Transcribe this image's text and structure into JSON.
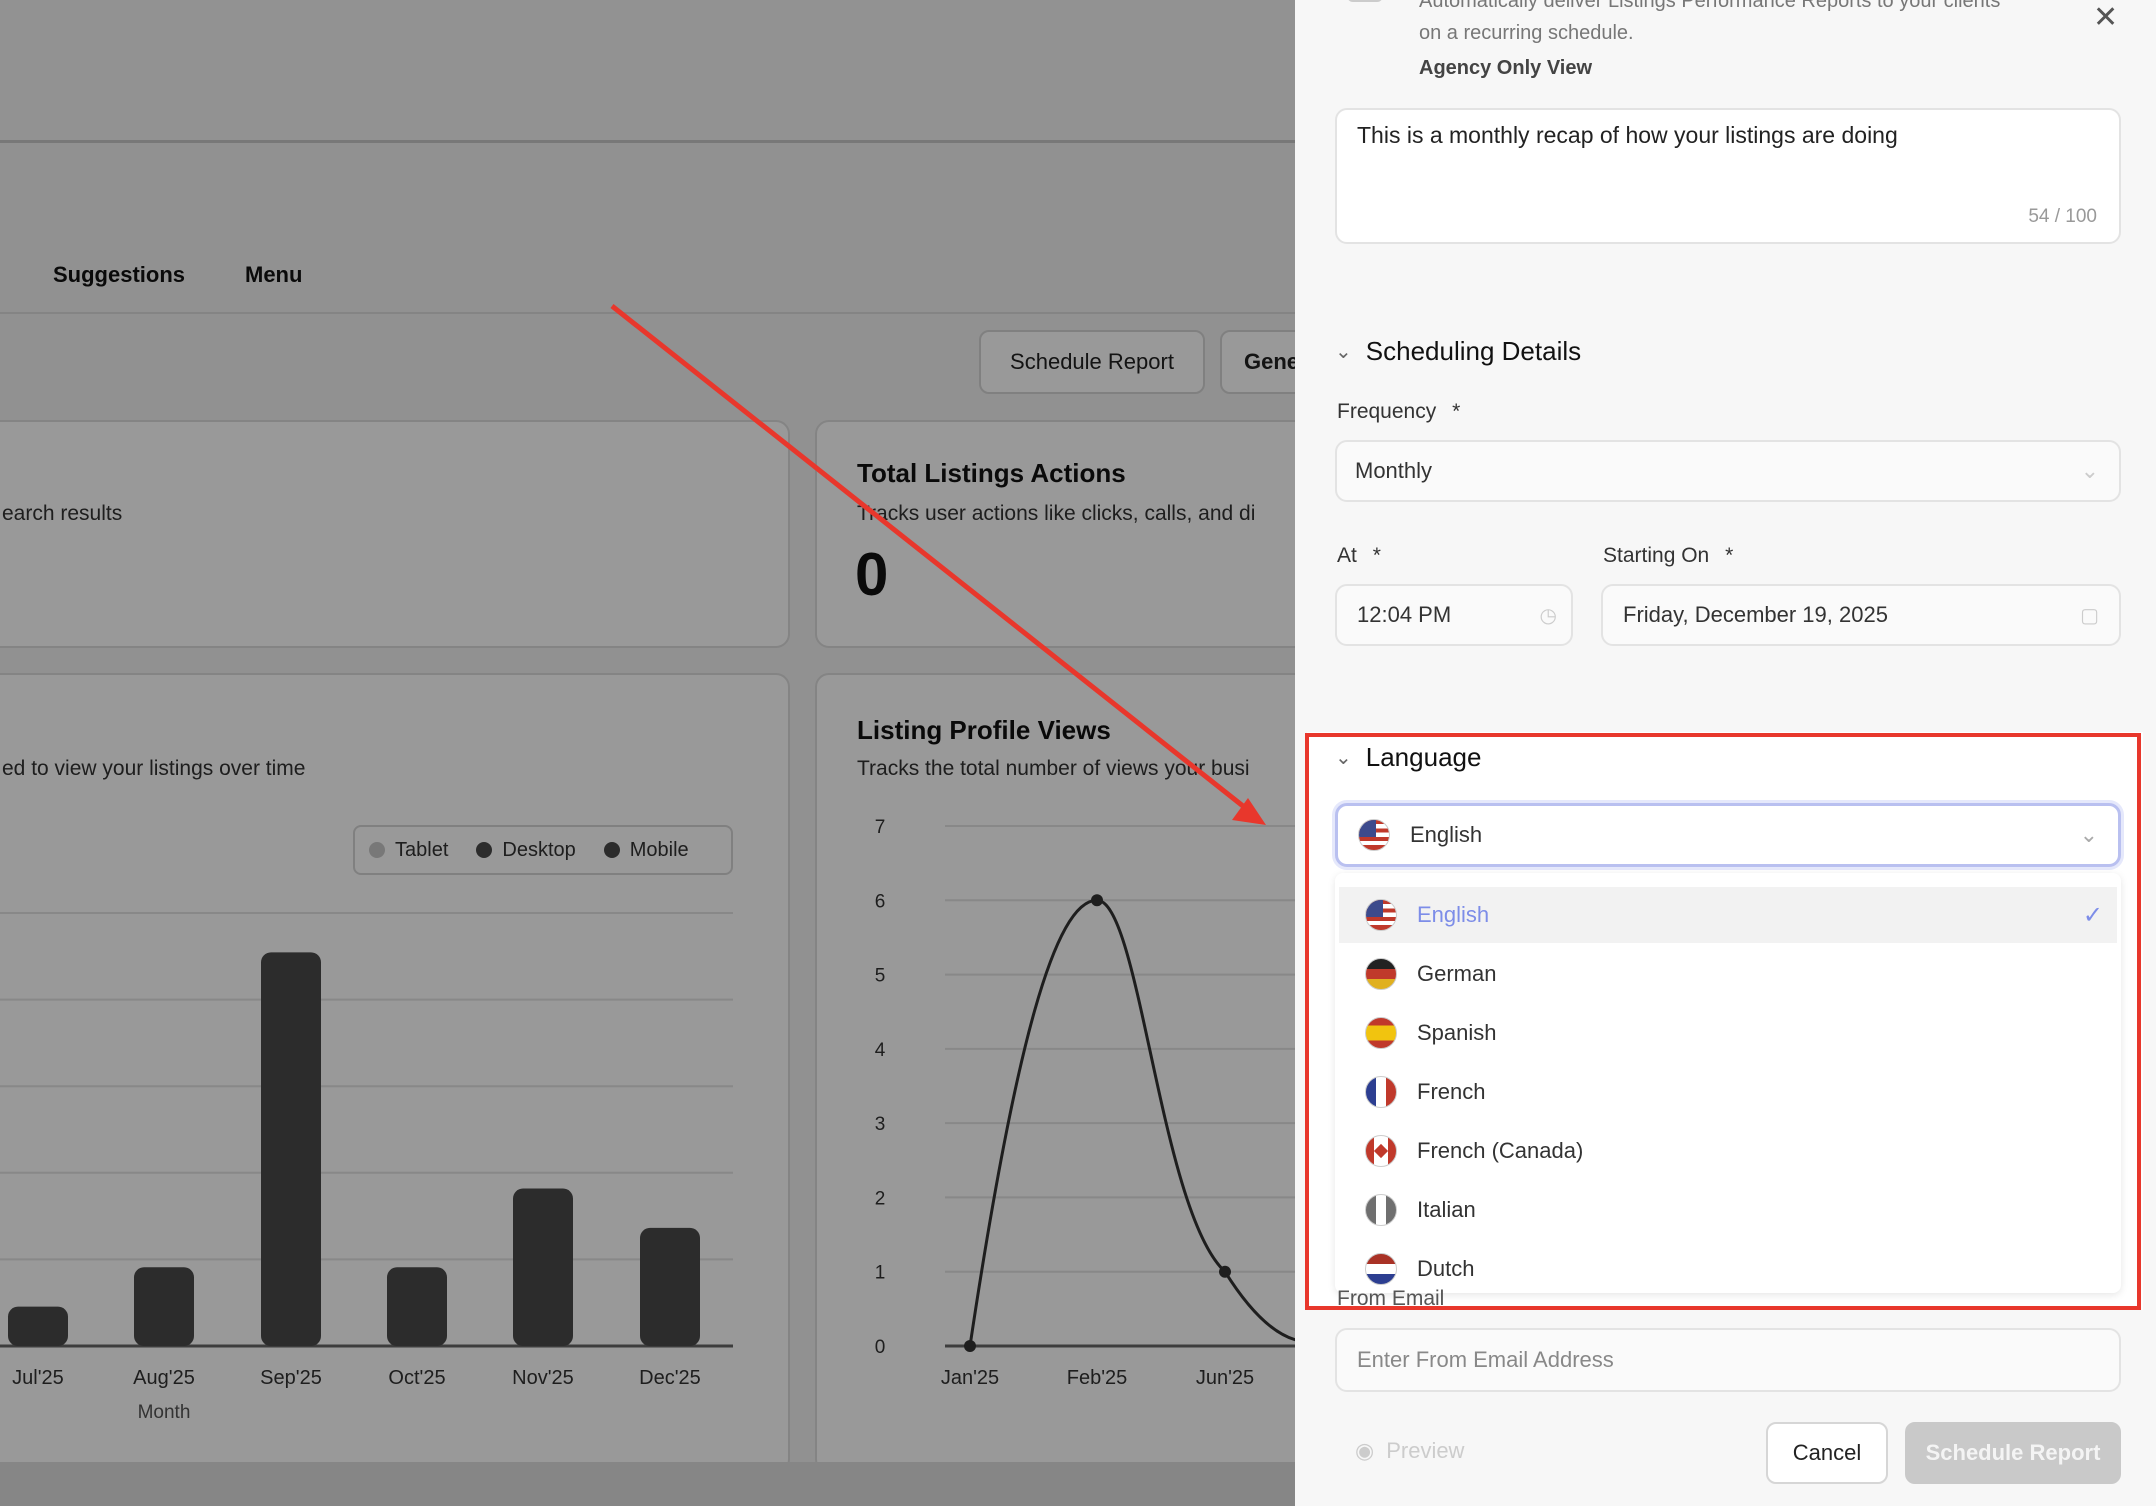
{
  "tabs": [
    {
      "label": "Suggestions"
    },
    {
      "label": "Menu"
    }
  ],
  "toolbar": {
    "schedule_label": "Schedule Report",
    "generate_label": "Gene"
  },
  "cards": {
    "left_top_sub": "earch results",
    "actions_title": "Total Listings Actions",
    "actions_sub": "Tracks user actions like clicks, calls, and di",
    "actions_value": "0",
    "left_bottom_sub": "ed to view your listings over time",
    "views_title": "Listing Profile Views",
    "views_sub": "Tracks the total number of views your busi"
  },
  "chart_data": [
    {
      "type": "bar",
      "categories": [
        "Jul'25",
        "Aug'25",
        "Sep'25",
        "Oct'25",
        "Nov'25",
        "Dec'25"
      ],
      "values": [
        0.5,
        1.0,
        5.0,
        1.0,
        2.0,
        1.5
      ],
      "ylim": [
        0,
        5.5
      ],
      "xlabel": "Month",
      "legend": [
        "Tablet",
        "Desktop",
        "Mobile"
      ],
      "legend_placement": "top-right",
      "colors": {
        "bar": "#4a4a4a",
        "tablet": "#c8c8c8",
        "desktop": "#4a4a4a",
        "mobile": "#4a4a4a"
      }
    },
    {
      "type": "line",
      "categories": [
        "Jan'25",
        "Feb'25",
        "Jun'25"
      ],
      "values": [
        0,
        6,
        1
      ],
      "ylim": [
        0,
        7
      ],
      "yticks": [
        "0",
        "1",
        "2",
        "3",
        "4",
        "5",
        "6",
        "7"
      ]
    }
  ],
  "panel": {
    "desc_line1": "Automatically deliver Listings Performance Reports to your clients",
    "desc_line2": "on a recurring schedule.",
    "agency": "Agency Only View",
    "message": "This is a monthly recap of how your listings are doing",
    "counter": "54 / 100",
    "scheduling_title": "Scheduling Details",
    "frequency_label": "Frequency",
    "required_mark": "*",
    "frequency_value": "Monthly",
    "at_label": "At",
    "time_value": "12:04 PM",
    "starting_label": "Starting On",
    "date_value": "Friday, December 19, 2025",
    "language_title": "Language",
    "selected_language": "English",
    "options": [
      {
        "label": "English",
        "selected": true
      },
      {
        "label": "German"
      },
      {
        "label": "Spanish"
      },
      {
        "label": "French"
      },
      {
        "label": "French (Canada)"
      },
      {
        "label": "Italian"
      },
      {
        "label": "Dutch"
      }
    ],
    "from_email_label": "From Email",
    "from_email_placeholder": "Enter From Email Address",
    "preview_label": "Preview",
    "cancel_label": "Cancel",
    "schedule_label": "Schedule Report"
  },
  "colors": {
    "accent": "#5b6ee1",
    "highlight": "#e8372c"
  }
}
